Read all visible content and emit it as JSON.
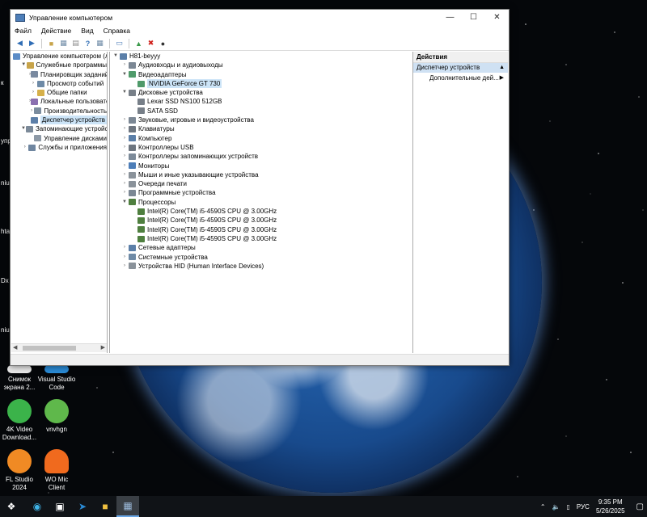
{
  "window": {
    "title": "Управление компьютером",
    "menu": [
      "Файл",
      "Действие",
      "Вид",
      "Справка"
    ]
  },
  "left_tree": [
    {
      "label": "Управление компьютером (л",
      "level": 0,
      "expander": "",
      "icon_color": "#5b8cc7",
      "selected": false
    },
    {
      "label": "Служебные программы",
      "level": 1,
      "expander": "▼",
      "icon_color": "#c8a44a",
      "selected": false
    },
    {
      "label": "Планировщик заданий",
      "level": 2,
      "expander": "›",
      "icon_color": "#7a8aa0",
      "selected": false
    },
    {
      "label": "Просмотр событий",
      "level": 2,
      "expander": "›",
      "icon_color": "#6e8aa6",
      "selected": false
    },
    {
      "label": "Общие папки",
      "level": 2,
      "expander": "›",
      "icon_color": "#d6b04a",
      "selected": false
    },
    {
      "label": "Локальные пользовате",
      "level": 2,
      "expander": "›",
      "icon_color": "#8a6fb0",
      "selected": false
    },
    {
      "label": "Производительность",
      "level": 2,
      "expander": "›",
      "icon_color": "#7b8c9e",
      "selected": false
    },
    {
      "label": "Диспетчер устройств",
      "level": 2,
      "expander": "",
      "icon_color": "#5d7fa8",
      "selected": true
    },
    {
      "label": "Запоминающие устройст",
      "level": 1,
      "expander": "▼",
      "icon_color": "#7c8a99",
      "selected": false
    },
    {
      "label": "Управление дисками",
      "level": 2,
      "expander": "",
      "icon_color": "#8d99a6",
      "selected": false
    },
    {
      "label": "Службы и приложения",
      "level": 1,
      "expander": "›",
      "icon_color": "#6f86a0",
      "selected": false
    }
  ],
  "device_tree": [
    {
      "label": "H81-beyyy",
      "level": 0,
      "expander": "▼",
      "icon_color": "#5b7fa8",
      "selected": false
    },
    {
      "label": "Аудиовходы и аудиовыходы",
      "level": 1,
      "expander": "›",
      "icon_color": "#7b8794",
      "selected": false
    },
    {
      "label": "Видеоадаптеры",
      "level": 1,
      "expander": "▼",
      "icon_color": "#4f9a6a",
      "selected": false
    },
    {
      "label": "NVIDIA GeForce GT 730",
      "level": 2,
      "expander": "",
      "icon_color": "#4f9a6a",
      "selected": true
    },
    {
      "label": "Дисковые устройства",
      "level": 1,
      "expander": "▼",
      "icon_color": "#777f88",
      "selected": false
    },
    {
      "label": "Lexar SSD NS100 512GB",
      "level": 2,
      "expander": "",
      "icon_color": "#777f88",
      "selected": false
    },
    {
      "label": "SATA SSD",
      "level": 2,
      "expander": "",
      "icon_color": "#777f88",
      "selected": false
    },
    {
      "label": "Звуковые, игровые и видеоустройства",
      "level": 1,
      "expander": "›",
      "icon_color": "#7b8794",
      "selected": false
    },
    {
      "label": "Клавиатуры",
      "level": 1,
      "expander": "›",
      "icon_color": "#6e7680",
      "selected": false
    },
    {
      "label": "Компьютер",
      "level": 1,
      "expander": "›",
      "icon_color": "#5b7fa8",
      "selected": false
    },
    {
      "label": "Контроллеры USB",
      "level": 1,
      "expander": "›",
      "icon_color": "#6e7680",
      "selected": false
    },
    {
      "label": "Контроллеры запоминающих устройств",
      "level": 1,
      "expander": "›",
      "icon_color": "#7c8a99",
      "selected": false
    },
    {
      "label": "Мониторы",
      "level": 1,
      "expander": "›",
      "icon_color": "#4d7eb8",
      "selected": false
    },
    {
      "label": "Мыши и иные указывающие устройства",
      "level": 1,
      "expander": "›",
      "icon_color": "#8a929a",
      "selected": false
    },
    {
      "label": "Очереди печати",
      "level": 1,
      "expander": "›",
      "icon_color": "#8a929a",
      "selected": false
    },
    {
      "label": "Программные устройства",
      "level": 1,
      "expander": "›",
      "icon_color": "#7b8794",
      "selected": false
    },
    {
      "label": "Процессоры",
      "level": 1,
      "expander": "▼",
      "icon_color": "#4f7f3f",
      "selected": false
    },
    {
      "label": "Intel(R) Core(TM) i5-4590S CPU @ 3.00GHz",
      "level": 2,
      "expander": "",
      "icon_color": "#4f7f3f",
      "selected": false
    },
    {
      "label": "Intel(R) Core(TM) i5-4590S CPU @ 3.00GHz",
      "level": 2,
      "expander": "",
      "icon_color": "#4f7f3f",
      "selected": false
    },
    {
      "label": "Intel(R) Core(TM) i5-4590S CPU @ 3.00GHz",
      "level": 2,
      "expander": "",
      "icon_color": "#4f7f3f",
      "selected": false
    },
    {
      "label": "Intel(R) Core(TM) i5-4590S CPU @ 3.00GHz",
      "level": 2,
      "expander": "",
      "icon_color": "#4f7f3f",
      "selected": false
    },
    {
      "label": "Сетевые адаптеры",
      "level": 1,
      "expander": "›",
      "icon_color": "#5b7fa8",
      "selected": false
    },
    {
      "label": "Системные устройства",
      "level": 1,
      "expander": "›",
      "icon_color": "#6e8aa6",
      "selected": false
    },
    {
      "label": "Устройства HID (Human Interface Devices)",
      "level": 1,
      "expander": "›",
      "icon_color": "#8a929a",
      "selected": false
    }
  ],
  "actions": {
    "header": "Действия",
    "section": "Диспетчер устройств",
    "more": "Дополнительные дей..."
  },
  "desktop": {
    "icons": [
      {
        "name": "snip",
        "label": "Снимок экрана 2...",
        "color": "#e8e8e8"
      },
      {
        "name": "vscode",
        "label": "Visual Studio Code",
        "color": "#2a8ad4"
      },
      {
        "name": "4kvideo",
        "label": "4K Video Download...",
        "color": "#3bb34a"
      },
      {
        "name": "utorrent",
        "label": "vnvhgn",
        "color": "#5fb84b"
      },
      {
        "name": "flstudio",
        "label": "FL Studio 2024",
        "color": "#f08a24"
      },
      {
        "name": "womic",
        "label": "WO Mic Client",
        "color": "#f06a1e"
      }
    ],
    "edge_labels": [
      "к",
      "упра",
      "niu",
      "hta",
      "Dx",
      "niu"
    ]
  },
  "taskbar": {
    "tray_lang": "РУС",
    "time": "9:35 PM",
    "date": "5/26/2025"
  }
}
